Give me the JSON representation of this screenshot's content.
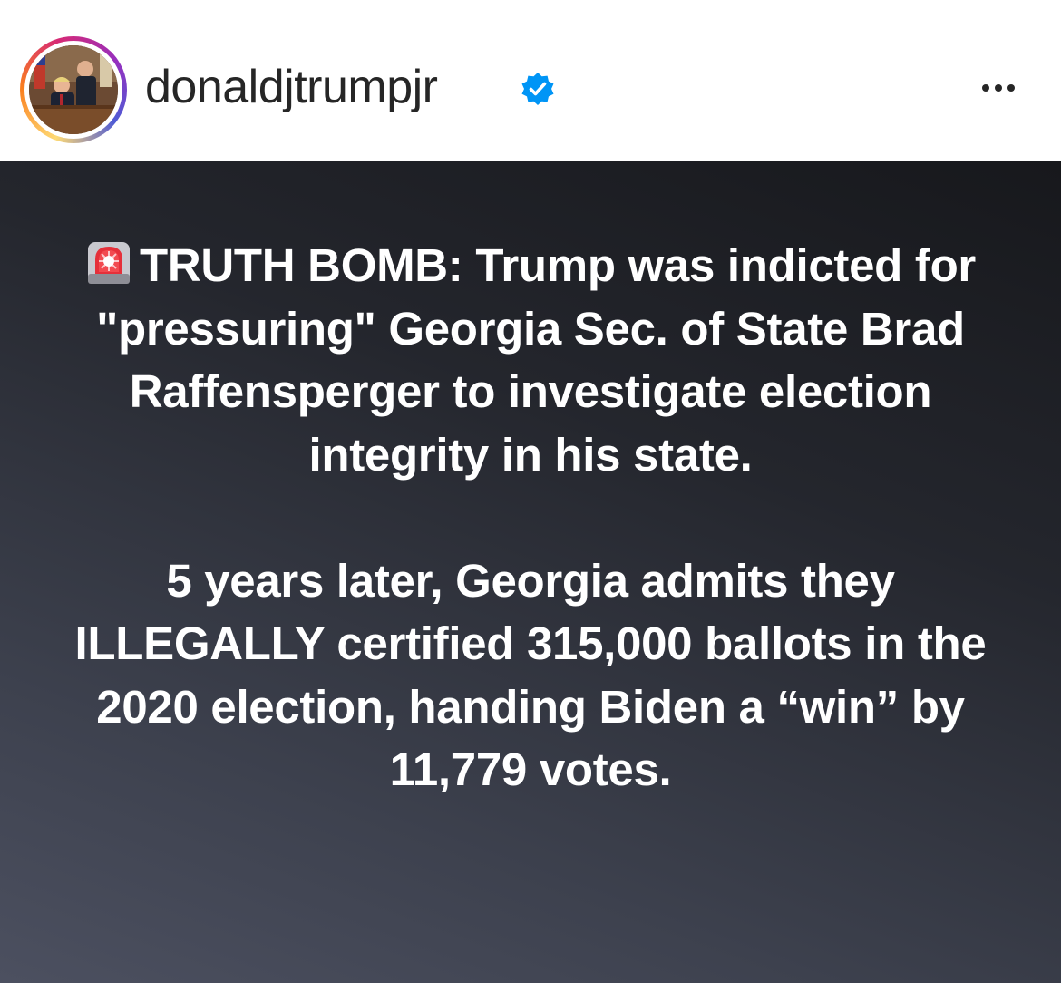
{
  "post": {
    "username": "donaldjtrumpjr",
    "verified_icon": "verified-badge-icon",
    "more_icon": "more-options-icon",
    "more_label": "•••",
    "emoji": "siren-icon",
    "paragraph1": "TRUTH BOMB: Trump was indicted for \"pressuring\" Georgia Sec. of State Brad Raffensperger to investigate election integrity in his state.",
    "paragraph2": "5 years later, Georgia admits they ILLEGALLY certified 315,000 ballots in the 2020 election, handing Biden a “win” by 11,779 votes."
  },
  "colors": {
    "verified": "#0095f6",
    "username": "#262626",
    "post_bg_dark": "#17181c",
    "post_bg_light": "#4c5060",
    "post_text": "#ffffff"
  }
}
